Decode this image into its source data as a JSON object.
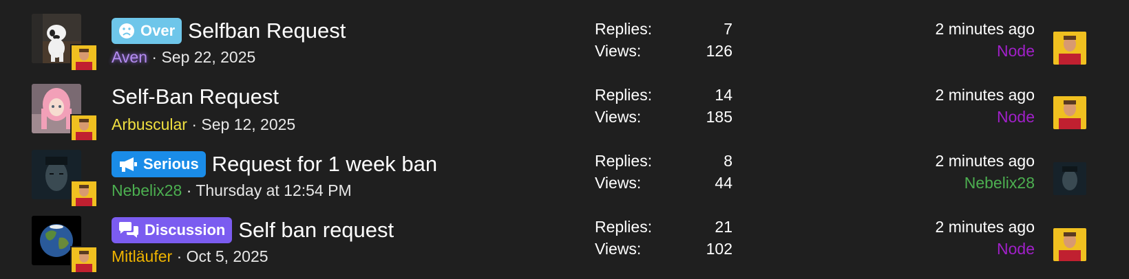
{
  "threads": [
    {
      "prefix": "Over",
      "prefix_icon": "frown-face-icon",
      "prefix_color": "#6ec6ea",
      "title": "Selfban Request",
      "author": "Aven",
      "date": "· Sep 22, 2025",
      "replies_label": "Replies:",
      "replies": "7",
      "views_label": "Views:",
      "views": "126",
      "last_time": "2 minutes ago",
      "last_user": "Node"
    },
    {
      "prefix": "",
      "title": "Self-Ban Request",
      "author": "Arbuscular",
      "date": "· Sep 12, 2025",
      "replies_label": "Replies:",
      "replies": "14",
      "views_label": "Views:",
      "views": "185",
      "last_time": "2 minutes ago",
      "last_user": "Node"
    },
    {
      "prefix": "Serious",
      "prefix_icon": "megaphone-icon",
      "prefix_color": "#1a8ce8",
      "title": "Request for 1 week ban",
      "author": "Nebelix28",
      "date": "· Thursday at 12:54 PM",
      "replies_label": "Replies:",
      "replies": "8",
      "views_label": "Views:",
      "views": "44",
      "last_time": "2 minutes ago",
      "last_user": "Nebelix28"
    },
    {
      "prefix": "Discussion",
      "prefix_icon": "chat-bubbles-icon",
      "prefix_color": "#7b5cf0",
      "title": "Self ban request",
      "author": "Mitläufer",
      "date": "· Oct 5, 2025",
      "replies_label": "Replies:",
      "replies": "21",
      "views_label": "Views:",
      "views": "102",
      "last_time": "2 minutes ago",
      "last_user": "Node"
    }
  ]
}
